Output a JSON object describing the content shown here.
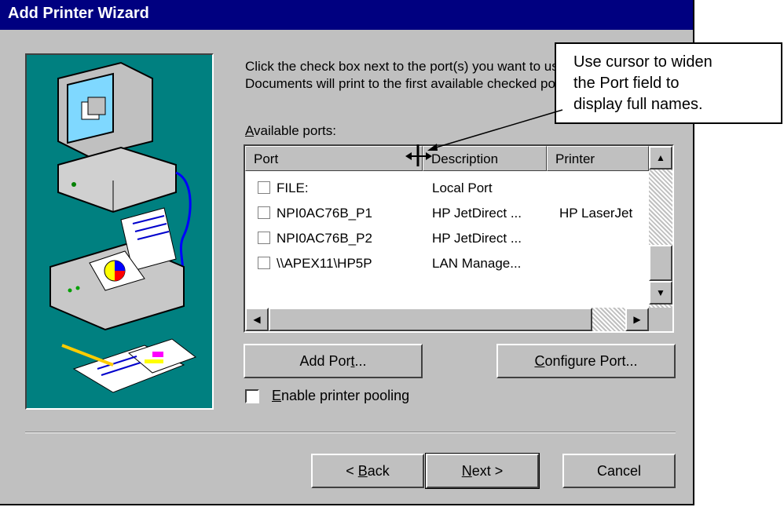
{
  "window": {
    "title": "Add Printer Wizard"
  },
  "instructions": {
    "line1": "Click the check box next to the port(s) you want to use.",
    "line2": "Documents will print to the first available checked port."
  },
  "ports_label_prefix": "",
  "ports_label_accel": "A",
  "ports_label_rest": "vailable ports:",
  "columns": {
    "port": "Port",
    "description": "Description",
    "printer": "Printer"
  },
  "ports": [
    {
      "port": "FILE:",
      "description": "Local Port",
      "printer": ""
    },
    {
      "port": "NPI0AC76B_P1",
      "description": "HP JetDirect ...",
      "printer": "HP LaserJet"
    },
    {
      "port": "NPI0AC76B_P2",
      "description": "HP JetDirect ...",
      "printer": ""
    },
    {
      "port": "\\\\APEX11\\HP5P",
      "description": "LAN Manage...",
      "printer": ""
    }
  ],
  "buttons": {
    "add_port_pre": "Add Por",
    "add_port_accel": "t",
    "add_port_post": "...",
    "configure_accel": "C",
    "configure_rest": "onfigure Port...",
    "back_pre": "< ",
    "back_accel": "B",
    "back_rest": "ack",
    "next_accel": "N",
    "next_rest": "ext >",
    "cancel": "Cancel"
  },
  "pooling": {
    "accel": "E",
    "rest": "nable printer pooling",
    "checked": false
  },
  "callout": {
    "line1": "Use cursor to widen",
    "line2": "the Port field to",
    "line3": "display full names."
  },
  "colors": {
    "titlebar": "#000080",
    "panel": "#008080",
    "face": "#c0c0c0"
  }
}
